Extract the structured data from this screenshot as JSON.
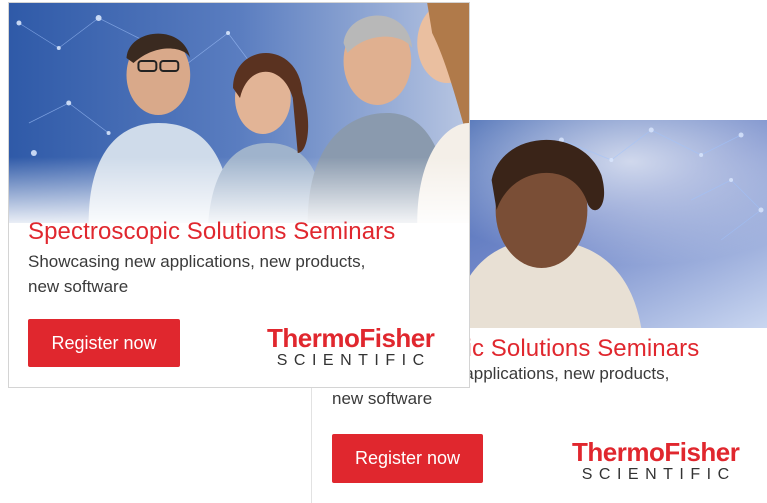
{
  "ads": [
    {
      "headline": "Spectroscopic Solutions Seminars",
      "subline_1": "Showcasing new applications, new products,",
      "subline_2": "new software",
      "button_label": "Register now",
      "logo_main": "ThermoFisher",
      "logo_sub": "SCIENTIFIC"
    },
    {
      "headline": "Spectroscopic Solutions Seminars",
      "subline_1": "Showcasing new applications, new products,",
      "subline_2": "new software",
      "button_label": "Register now",
      "logo_main": "ThermoFisher",
      "logo_sub": "SCIENTIFIC"
    }
  ],
  "colors": {
    "accent": "#e0272e",
    "body_text": "#3a3a3a",
    "photo_bg": "#3a5fa8"
  }
}
